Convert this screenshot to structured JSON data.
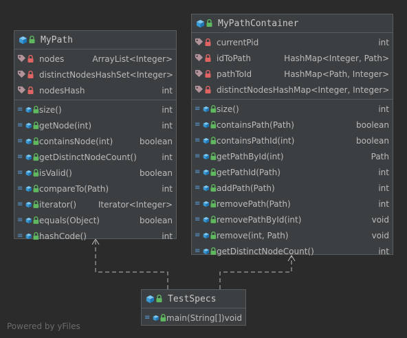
{
  "classes": {
    "mypath": {
      "name": "MyPath",
      "fields": [
        {
          "name": "nodes",
          "type": "ArrayList<Integer>"
        },
        {
          "name": "distinctNodes",
          "type": "HashSet<Integer>"
        },
        {
          "name": "nodesHash",
          "type": "int"
        }
      ],
      "methods": [
        {
          "name": "size()",
          "type": "int"
        },
        {
          "name": "getNode(int)",
          "type": "int"
        },
        {
          "name": "containsNode(int)",
          "type": "boolean"
        },
        {
          "name": "getDistinctNodeCount()",
          "type": "int"
        },
        {
          "name": "isValid()",
          "type": "boolean"
        },
        {
          "name": "compareTo(Path)",
          "type": "int"
        },
        {
          "name": "iterator()",
          "type": "Iterator<Integer>"
        },
        {
          "name": "equals(Object)",
          "type": "boolean"
        },
        {
          "name": "hashCode()",
          "type": "int"
        }
      ]
    },
    "mypathcontainer": {
      "name": "MyPathContainer",
      "fields": [
        {
          "name": "currentPid",
          "type": "int"
        },
        {
          "name": "idToPath",
          "type": "HashMap<Integer, Path>"
        },
        {
          "name": "pathToId",
          "type": "HashMap<Path, Integer>"
        },
        {
          "name": "distinctNodes",
          "type": "HashMap<Integer, Integer>"
        }
      ],
      "methods": [
        {
          "name": "size()",
          "type": "int"
        },
        {
          "name": "containsPath(Path)",
          "type": "boolean"
        },
        {
          "name": "containsPathId(int)",
          "type": "boolean"
        },
        {
          "name": "getPathById(int)",
          "type": "Path"
        },
        {
          "name": "getPathId(Path)",
          "type": "int"
        },
        {
          "name": "addPath(Path)",
          "type": "int"
        },
        {
          "name": "removePath(Path)",
          "type": "int"
        },
        {
          "name": "removePathById(int)",
          "type": "void"
        },
        {
          "name": "remove(int, Path)",
          "type": "void"
        },
        {
          "name": "getDistinctNodeCount()",
          "type": "int"
        }
      ]
    },
    "testspecs": {
      "name": "TestSpecs",
      "fields": [],
      "methods": [
        {
          "name": "main(String[])",
          "type": "void"
        }
      ]
    }
  },
  "footer": "Powered by yFiles",
  "colors": {
    "background": "#2b2b2b",
    "box": "#3c3f41",
    "class_icon": "#40a8e0",
    "field_icon": "#b4939b",
    "lock_icon": "#e06464",
    "lock_green": "#5fb85f"
  }
}
